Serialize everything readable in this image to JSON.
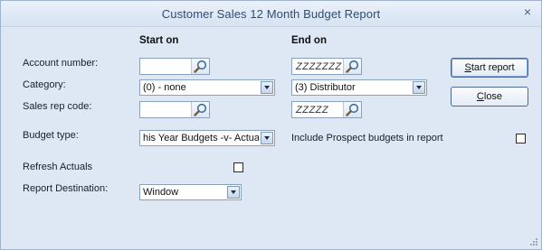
{
  "window": {
    "title": "Customer Sales 12 Month Budget Report",
    "close_glyph": "×"
  },
  "columns": {
    "start": "Start on",
    "end": "End on"
  },
  "fields": {
    "account_number": {
      "label": "Account number:",
      "start_value": "",
      "end_value": "ZZZZZZZ"
    },
    "category": {
      "label": "Category:",
      "start_value": "(0) - none",
      "end_value": "(3) Distributor"
    },
    "sales_rep_code": {
      "label": "Sales rep code:",
      "start_value": "",
      "end_value": "ZZZZZ"
    },
    "budget_type": {
      "label": "Budget type:",
      "value": "his Year Budgets -v- Actuals"
    },
    "include_prospect": {
      "label": "Include Prospect budgets in report",
      "checked": false
    },
    "refresh_actuals": {
      "label": "Refresh Actuals",
      "checked": false
    },
    "report_destination": {
      "label": "Report Destination:",
      "value": "Window"
    }
  },
  "buttons": {
    "start_report_prefix": "S",
    "start_report_rest": "tart report",
    "close_prefix": "C",
    "close_rest": "lose"
  },
  "icons": {
    "lookup": "magnifier-icon",
    "dropdown": "chevron-down-icon",
    "close": "close-icon"
  },
  "colors": {
    "window_bg": "#dde8f4",
    "title_text": "#2e4d77",
    "field_border": "#8aa0bb"
  }
}
